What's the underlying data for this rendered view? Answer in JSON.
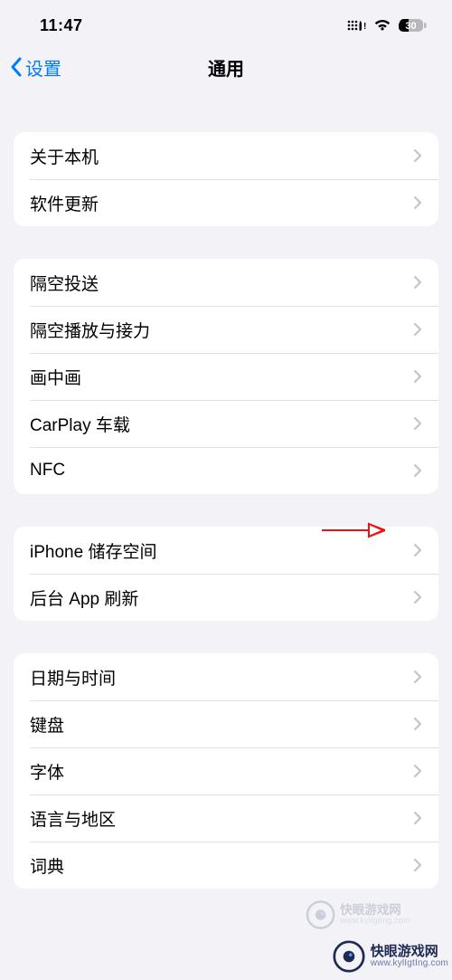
{
  "status": {
    "time": "11:47",
    "battery_text": "30"
  },
  "nav": {
    "back_label": "设置",
    "title": "通用"
  },
  "groups": [
    {
      "rows": [
        {
          "id": "about",
          "label": "关于本机"
        },
        {
          "id": "software-update",
          "label": "软件更新"
        }
      ]
    },
    {
      "rows": [
        {
          "id": "airdrop",
          "label": "隔空投送"
        },
        {
          "id": "airplay-handoff",
          "label": "隔空播放与接力"
        },
        {
          "id": "picture-in-picture",
          "label": "画中画"
        },
        {
          "id": "carplay",
          "label": "CarPlay 车载"
        },
        {
          "id": "nfc",
          "label": "NFC"
        }
      ]
    },
    {
      "rows": [
        {
          "id": "iphone-storage",
          "label": "iPhone 储存空间"
        },
        {
          "id": "background-app-refresh",
          "label": "后台 App 刷新"
        }
      ]
    },
    {
      "rows": [
        {
          "id": "date-time",
          "label": "日期与时间"
        },
        {
          "id": "keyboard",
          "label": "键盘"
        },
        {
          "id": "fonts",
          "label": "字体"
        },
        {
          "id": "language-region",
          "label": "语言与地区"
        },
        {
          "id": "dictionary",
          "label": "词典"
        }
      ]
    }
  ],
  "watermark": {
    "brand_cn": "快眼游戏网",
    "url": "www.kylIgtIng.com"
  }
}
